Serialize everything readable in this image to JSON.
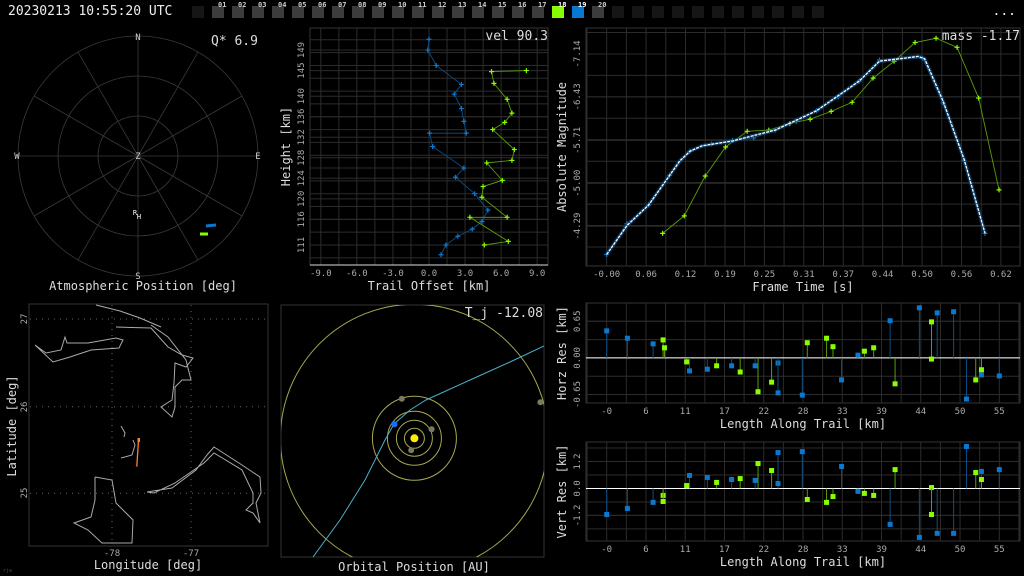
{
  "header": {
    "timestamp": "20230213 10:55:20 UTC",
    "more_label": "...",
    "frames": [
      {
        "label": "",
        "state": "empty"
      },
      {
        "label": "01"
      },
      {
        "label": "02"
      },
      {
        "label": "03"
      },
      {
        "label": "04"
      },
      {
        "label": "05"
      },
      {
        "label": "06"
      },
      {
        "label": "07"
      },
      {
        "label": "08"
      },
      {
        "label": "09"
      },
      {
        "label": "10"
      },
      {
        "label": "11"
      },
      {
        "label": "12"
      },
      {
        "label": "13"
      },
      {
        "label": "14"
      },
      {
        "label": "15"
      },
      {
        "label": "16"
      },
      {
        "label": "17"
      },
      {
        "label": "18",
        "state": "green"
      },
      {
        "label": "19",
        "state": "blue"
      },
      {
        "label": "20"
      },
      {
        "label": "",
        "state": "empty"
      },
      {
        "label": "",
        "state": "empty"
      },
      {
        "label": "",
        "state": "empty"
      },
      {
        "label": "",
        "state": "empty"
      },
      {
        "label": "",
        "state": "empty"
      },
      {
        "label": "",
        "state": "empty"
      },
      {
        "label": "",
        "state": "empty"
      },
      {
        "label": "",
        "state": "empty"
      },
      {
        "label": "",
        "state": "empty"
      },
      {
        "label": "",
        "state": "empty"
      },
      {
        "label": "",
        "state": "empty"
      }
    ]
  },
  "colors": {
    "blue": "#0a78d0",
    "green": "#88ff00",
    "blue_line": "#0b4f86",
    "green_line": "#5a9c0a",
    "fit": "#ffffff",
    "grid": "#2c2c2c",
    "orbit": "#a8a850",
    "trajectory": "#4ab0c8",
    "sun": "#ffee00",
    "earth": "#1070ff",
    "track": "#ff8030"
  },
  "sky": {
    "title": "Atmospheric Position [deg]",
    "stat": "Q*  6.9",
    "n": "N",
    "s": "S",
    "e": "E",
    "w": "W",
    "z": "Z",
    "station_r": "R",
    "station_h": "H"
  },
  "map": {
    "title": "Longitude [deg]",
    "ylabel": "Latitude [deg]",
    "xticks": [
      "-78",
      "-77"
    ],
    "yticks": [
      "27",
      "26",
      "25"
    ],
    "ground_track": {
      "start": [
        -77.66,
        25.63
      ],
      "end": [
        -77.69,
        25.31
      ]
    },
    "corner": "rjw"
  },
  "orbit": {
    "title": "Orbital Position [AU]",
    "stat": "T_j -12.08"
  },
  "chart_data": [
    {
      "id": "trail",
      "type": "line",
      "title": "vel 90.3",
      "xlabel": "Trail Offset [km]",
      "ylabel": "Height [km]",
      "xlim": [
        -9.9,
        9.9
      ],
      "ylim": [
        107.1,
        153.3
      ],
      "xticks": [
        [
          -9,
          "-9.0"
        ],
        [
          -6,
          "-6.0"
        ],
        [
          -3,
          "-3.0"
        ],
        [
          0,
          "0.0"
        ],
        [
          3,
          "3.0"
        ],
        [
          6,
          "6.0"
        ],
        [
          9,
          "9.0"
        ]
      ],
      "yticks": [
        [
          111,
          "111"
        ],
        [
          116,
          "116"
        ],
        [
          120,
          "120"
        ],
        [
          124,
          "124"
        ],
        [
          128,
          "128"
        ],
        [
          132,
          "132"
        ],
        [
          136,
          "136"
        ],
        [
          140,
          "140"
        ],
        [
          145,
          "145"
        ],
        [
          149,
          "149"
        ]
      ],
      "series": [
        {
          "name": "station-blue",
          "color": "blue",
          "points": [
            [
              0.0,
              151.1
            ],
            [
              -0.1,
              149
            ],
            [
              0.6,
              146
            ],
            [
              2.7,
              142.3
            ],
            [
              2.1,
              140.4
            ],
            [
              2.7,
              137.6
            ],
            [
              2.9,
              135.1
            ],
            [
              3.1,
              132.8
            ],
            [
              0.05,
              132.8
            ],
            [
              0.3,
              130.2
            ],
            [
              2.9,
              126
            ],
            [
              2.2,
              124.2
            ],
            [
              3.8,
              121
            ],
            [
              4.9,
              117.8
            ],
            [
              4.4,
              115.6
            ],
            [
              3.6,
              114.1
            ],
            [
              2.4,
              112.7
            ],
            [
              1.4,
              111
            ],
            [
              1.0,
              109.1
            ]
          ]
        },
        {
          "name": "station-green",
          "color": "green",
          "points": [
            [
              8.1,
              145
            ],
            [
              5.2,
              144.8
            ],
            [
              5.4,
              142.5
            ],
            [
              6.5,
              139.4
            ],
            [
              6.9,
              136.7
            ],
            [
              6.3,
              134.9
            ],
            [
              5.3,
              133.5
            ],
            [
              7.1,
              129.6
            ],
            [
              6.9,
              127.5
            ],
            [
              4.8,
              127
            ],
            [
              6.1,
              123.6
            ],
            [
              4.5,
              122.4
            ],
            [
              4.4,
              120.3
            ],
            [
              6.5,
              116.4
            ],
            [
              3.4,
              116.4
            ],
            [
              6.6,
              111.7
            ],
            [
              4.6,
              111
            ]
          ]
        }
      ]
    },
    {
      "id": "lightcurve",
      "type": "line",
      "title": "mass -1.17",
      "xlabel": "Frame Time [s]",
      "ylabel": "Absolute Magnitude",
      "xlim": [
        -0.0325,
        0.65
      ],
      "ylim": [
        -3.63,
        -7.57
      ],
      "xticks": [
        [
          0,
          "-0.00"
        ],
        [
          0.062,
          "0.06"
        ],
        [
          0.124,
          "0.12"
        ],
        [
          0.186,
          "0.19"
        ],
        [
          0.248,
          "0.25"
        ],
        [
          0.31,
          "0.31"
        ],
        [
          0.372,
          "0.37"
        ],
        [
          0.434,
          "0.44"
        ],
        [
          0.496,
          "0.50"
        ],
        [
          0.558,
          "0.56"
        ],
        [
          0.62,
          "0.62"
        ]
      ],
      "yticks": [
        [
          -7.14,
          "-7.14"
        ],
        [
          -6.43,
          "-6.43"
        ],
        [
          -5.71,
          "-5.71"
        ],
        [
          -5.0,
          "-5.00"
        ],
        [
          -4.29,
          "-4.29"
        ]
      ],
      "series": [
        {
          "name": "station-blue",
          "color": "blue",
          "points": [
            [
              0,
              -3.82
            ],
            [
              0.032,
              -4.33
            ],
            [
              0.066,
              -4.64
            ],
            [
              0.099,
              -5.13
            ],
            [
              0.131,
              -5.53
            ],
            [
              0.165,
              -5.65
            ],
            [
              0.198,
              -5.71
            ],
            [
              0.231,
              -5.75
            ],
            [
              0.265,
              -5.88
            ],
            [
              0.298,
              -6.02
            ],
            [
              0.33,
              -6.2
            ],
            [
              0.364,
              -6.43
            ],
            [
              0.397,
              -6.69
            ],
            [
              0.429,
              -7.04
            ],
            [
              0.464,
              -7.07
            ],
            [
              0.497,
              -7.07
            ],
            [
              0.529,
              -6.33
            ],
            [
              0.562,
              -5.38
            ],
            [
              0.595,
              -4.17
            ]
          ]
        },
        {
          "name": "station-green",
          "color": "green",
          "points": [
            [
              0.088,
              -4.17
            ],
            [
              0.122,
              -4.46
            ],
            [
              0.155,
              -5.12
            ],
            [
              0.187,
              -5.6
            ],
            [
              0.221,
              -5.86
            ],
            [
              0.255,
              -5.88
            ],
            [
              0.288,
              -5.99
            ],
            [
              0.32,
              -6.06
            ],
            [
              0.353,
              -6.19
            ],
            [
              0.386,
              -6.34
            ],
            [
              0.419,
              -6.74
            ],
            [
              0.452,
              -7.02
            ],
            [
              0.485,
              -7.33
            ],
            [
              0.518,
              -7.4
            ],
            [
              0.551,
              -7.25
            ],
            [
              0.585,
              -6.41
            ],
            [
              0.617,
              -4.89
            ]
          ]
        },
        {
          "name": "fit",
          "color": "fit",
          "points": [
            [
              0,
              -3.82
            ],
            [
              0.032,
              -4.3
            ],
            [
              0.066,
              -4.64
            ],
            [
              0.099,
              -5.13
            ],
            [
              0.115,
              -5.37
            ],
            [
              0.131,
              -5.53
            ],
            [
              0.15,
              -5.62
            ],
            [
              0.198,
              -5.7
            ],
            [
              0.265,
              -5.88
            ],
            [
              0.33,
              -6.2
            ],
            [
              0.397,
              -6.69
            ],
            [
              0.429,
              -7.02
            ],
            [
              0.46,
              -7.06
            ],
            [
              0.49,
              -7.1
            ],
            [
              0.5,
              -7.06
            ],
            [
              0.529,
              -6.36
            ],
            [
              0.562,
              -5.4
            ],
            [
              0.595,
              -4.17
            ]
          ]
        }
      ]
    },
    {
      "id": "horz",
      "type": "scatter",
      "xlabel": "Length Along Trail [km]",
      "ylabel": "Horz Res [km]",
      "xlim": [
        -2.9,
        57.9
      ],
      "ylim": [
        -0.8,
        0.975
      ],
      "xticks": [
        [
          0,
          "-0"
        ],
        [
          5.5,
          "6"
        ],
        [
          11,
          "11"
        ],
        [
          16.5,
          "17"
        ],
        [
          22,
          "22"
        ],
        [
          27.5,
          "28"
        ],
        [
          33,
          "33"
        ],
        [
          38.5,
          "39"
        ],
        [
          44,
          "44"
        ],
        [
          49.5,
          "50"
        ],
        [
          55,
          "55"
        ]
      ],
      "yticks": [
        [
          0.65,
          "0.65"
        ],
        [
          0,
          "0.00"
        ],
        [
          -0.65,
          "-0.65"
        ]
      ],
      "series": [
        {
          "name": "station-blue",
          "color": "blue",
          "points": [
            [
              0,
              0.48
            ],
            [
              2.9,
              0.35
            ],
            [
              6.5,
              0.25
            ],
            [
              11.6,
              -0.23
            ],
            [
              14.1,
              -0.2
            ],
            [
              17.5,
              -0.14
            ],
            [
              20.8,
              -0.14
            ],
            [
              24,
              -0.09
            ],
            [
              24,
              -0.62
            ],
            [
              27.4,
              -0.66
            ],
            [
              32.9,
              -0.39
            ],
            [
              35.2,
              0.05
            ],
            [
              39.7,
              0.66
            ],
            [
              43.8,
              0.89
            ],
            [
              46.3,
              0.8
            ],
            [
              48.6,
              0.82
            ],
            [
              50.4,
              -0.73
            ],
            [
              52.5,
              -0.3
            ],
            [
              55,
              -0.32
            ]
          ]
        },
        {
          "name": "station-green",
          "color": "green",
          "points": [
            [
              7.9,
              0.32
            ],
            [
              8.1,
              0.18
            ],
            [
              11.2,
              -0.07
            ],
            [
              15.4,
              -0.14
            ],
            [
              18.7,
              -0.25
            ],
            [
              21.2,
              -0.6
            ],
            [
              23.1,
              -0.43
            ],
            [
              28.1,
              0.27
            ],
            [
              30.8,
              0.35
            ],
            [
              31.7,
              0.2
            ],
            [
              36.1,
              0.12
            ],
            [
              37.4,
              0.18
            ],
            [
              40.4,
              -0.46
            ],
            [
              45.5,
              0.64
            ],
            [
              45.5,
              -0.02
            ],
            [
              51.7,
              -0.39
            ],
            [
              52.5,
              -0.21
            ]
          ]
        }
      ]
    },
    {
      "id": "vert",
      "type": "scatter",
      "xlabel": "Length Along Trail [km]",
      "ylabel": "Vert Res [km]",
      "xlim": [
        -2.9,
        57.9
      ],
      "ylim": [
        -2.34,
        2.07
      ],
      "xticks": [
        [
          0,
          "-0"
        ],
        [
          5.5,
          "6"
        ],
        [
          11,
          "11"
        ],
        [
          16.5,
          "17"
        ],
        [
          22,
          "22"
        ],
        [
          27.5,
          "28"
        ],
        [
          33,
          "33"
        ],
        [
          38.5,
          "39"
        ],
        [
          44,
          "44"
        ],
        [
          49.5,
          "50"
        ],
        [
          55,
          "55"
        ]
      ],
      "yticks": [
        [
          1.2,
          "1.2"
        ],
        [
          0,
          "0.0"
        ],
        [
          -1.2,
          "-1.2"
        ]
      ],
      "series": [
        {
          "name": "station-blue",
          "color": "blue",
          "points": [
            [
              0,
              -1.16
            ],
            [
              2.9,
              -0.89
            ],
            [
              6.5,
              -0.62
            ],
            [
              11.6,
              0.58
            ],
            [
              14.1,
              0.49
            ],
            [
              17.5,
              0.4
            ],
            [
              20.8,
              0.36
            ],
            [
              24,
              1.6
            ],
            [
              24,
              0.22
            ],
            [
              27.4,
              1.64
            ],
            [
              32.9,
              0.98
            ],
            [
              35.2,
              -0.13
            ],
            [
              39.7,
              -1.6
            ],
            [
              43.8,
              -2.18
            ],
            [
              46.3,
              -2.0
            ],
            [
              48.6,
              -2.0
            ],
            [
              50.4,
              1.87
            ],
            [
              52.5,
              0.76
            ],
            [
              55,
              0.84
            ]
          ]
        },
        {
          "name": "station-green",
          "color": "green",
          "points": [
            [
              7.9,
              -0.31
            ],
            [
              7.9,
              -0.58
            ],
            [
              11.2,
              0.13
            ],
            [
              15.4,
              0.27
            ],
            [
              18.7,
              0.44
            ],
            [
              21.2,
              1.11
            ],
            [
              23.1,
              0.8
            ],
            [
              28.1,
              -0.49
            ],
            [
              30.8,
              -0.62
            ],
            [
              31.7,
              -0.36
            ],
            [
              36.1,
              -0.22
            ],
            [
              37.4,
              -0.31
            ],
            [
              40.4,
              0.84
            ],
            [
              45.5,
              0.04
            ],
            [
              45.5,
              -1.16
            ],
            [
              51.7,
              0.71
            ],
            [
              52.5,
              0.4
            ]
          ]
        }
      ]
    }
  ]
}
